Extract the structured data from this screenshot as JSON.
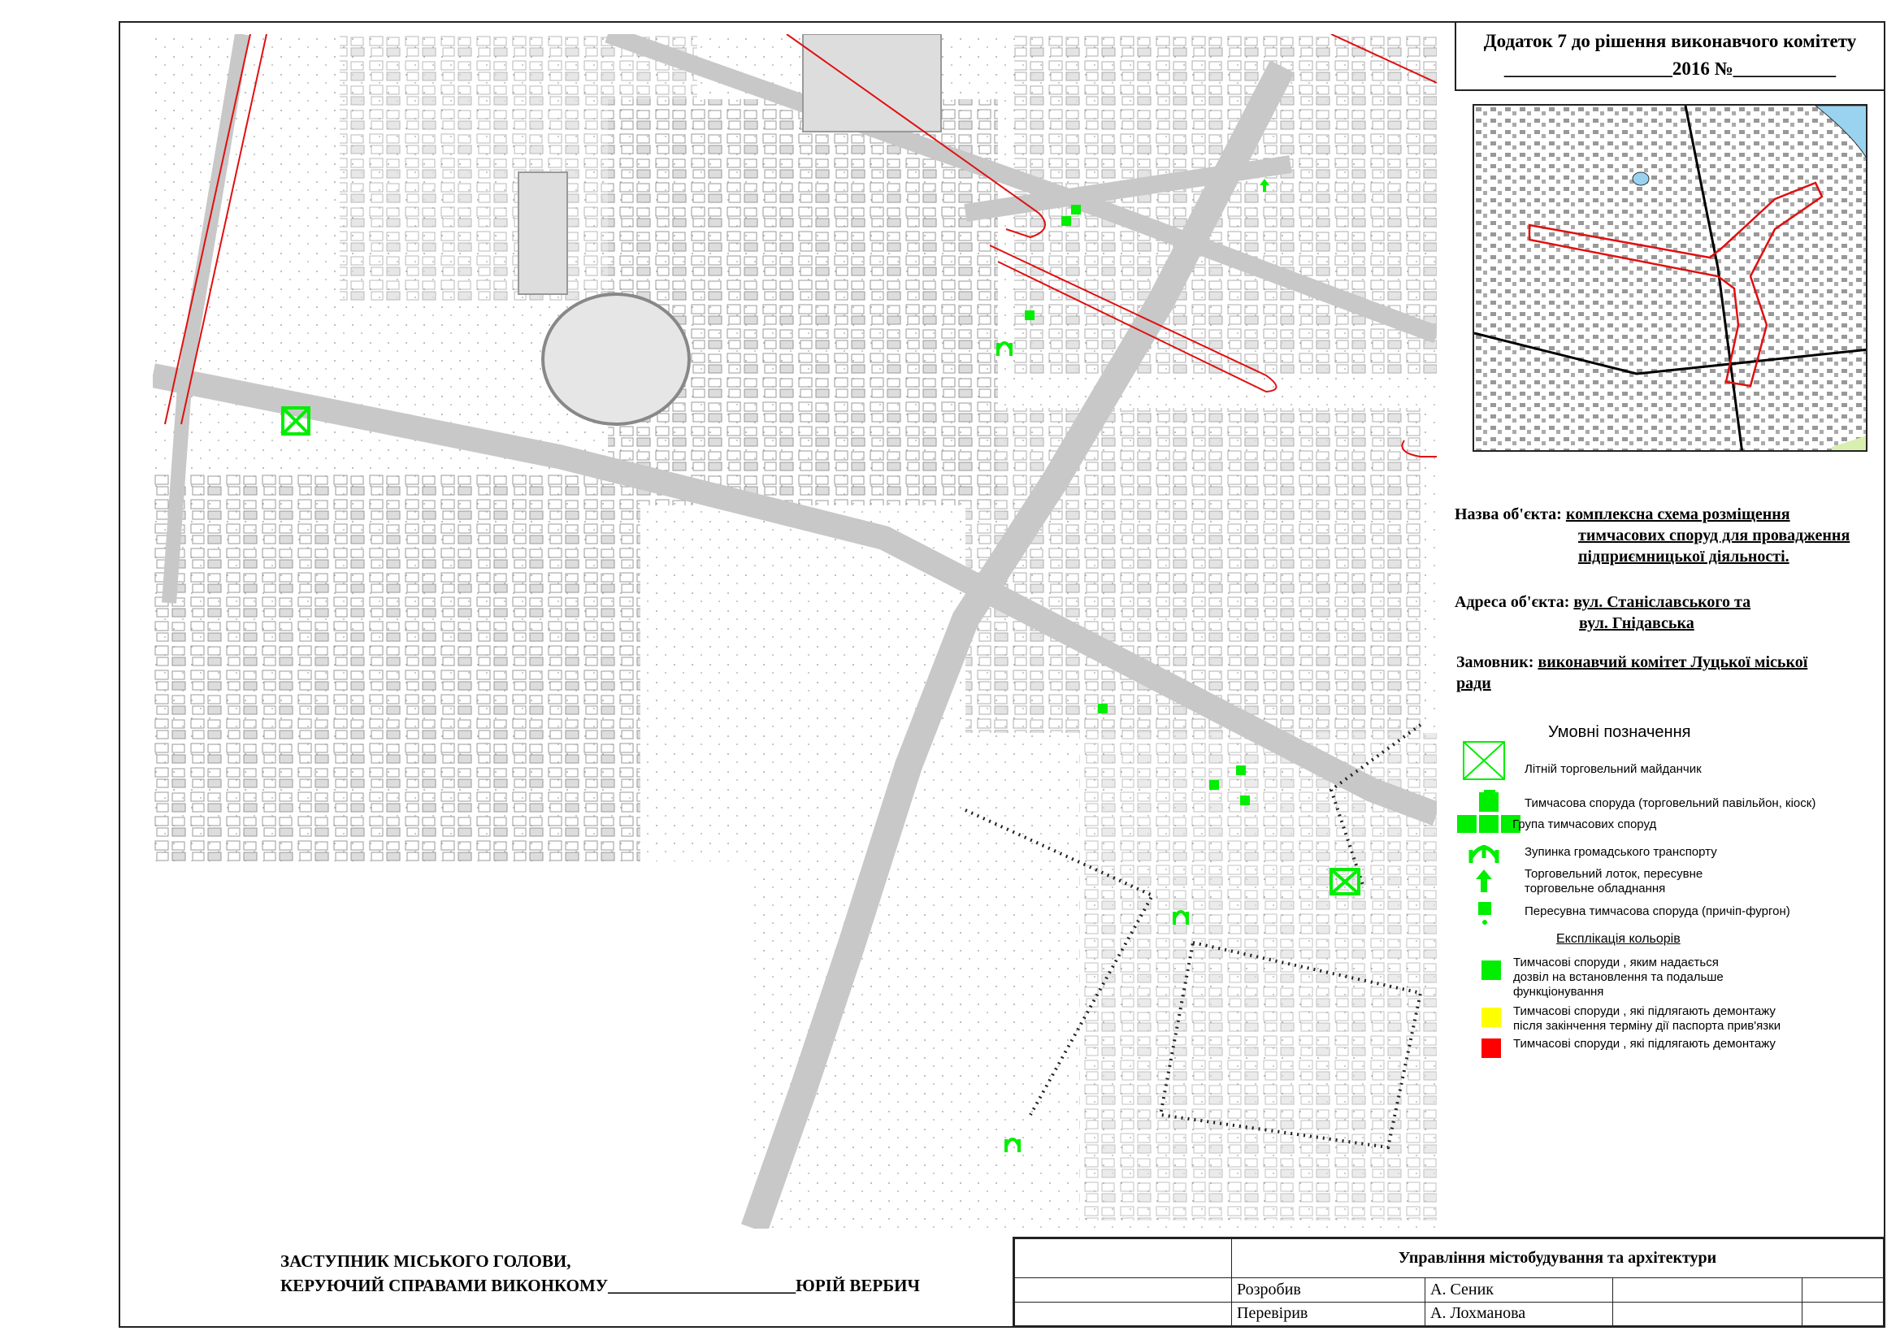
{
  "appendix": {
    "line1": "Додаток 7 до рішення виконавчого комітету",
    "line2": "__________________2016  №___________"
  },
  "object": {
    "name_label": "Назва об'єкта:",
    "name_value_1": "комплексна схема розміщення",
    "name_value_2": "тимчасових споруд для провадження",
    "name_value_3": "підприємницької діяльності.",
    "address_label": "Адреса об'єкта:",
    "address_value_1": "вул. Станіславського та",
    "address_value_2": "вул. Гнідавська",
    "customer_label": "Замовник:",
    "customer_value_1": "виконавчий комітет Луцької міської",
    "customer_value_2": "ради"
  },
  "legend": {
    "title": "Умовні позначення",
    "items": [
      "Літній торговельний майданчик",
      "Тимчасова споруда (торговельний павільйон, кіоск)",
      "Група тимчасових споруд",
      "Зупинка громадського транспорту",
      "Торговельний лоток, пересувне торговельне обладнання",
      "Пересувна тимчасова споруда (причіп-фургон)"
    ],
    "colors_title": "Експлікація кольорів",
    "color_items": [
      {
        "color": "#00ee00",
        "label": "Тимчасові споруди , яким надається дозвіл на встановлення та подальше функціонування"
      },
      {
        "color": "#ffff00",
        "label": "Тимчасові споруди , які підлягають демонтажу після закінчення терміну дії паспорта прив'язки"
      },
      {
        "color": "#ff0000",
        "label": "Тимчасові споруди , які підлягають демонтажу"
      }
    ]
  },
  "signature": {
    "line1": "ЗАСТУПНИК МІСЬКОГО ГОЛОВИ,",
    "line2": "КЕРУЮЧИЙ СПРАВАМИ ВИКОНКОМУ______________________ЮРІЙ ВЕРБИЧ"
  },
  "stamp": {
    "org": "Управління містобудування та архітектури",
    "developed_label": "Розробив",
    "developed_name": "А. Сеник",
    "checked_label": "Перевірив",
    "checked_name": "А. Лохманова"
  },
  "colors": {
    "green": "#00ee00",
    "redline": "#e01010"
  }
}
